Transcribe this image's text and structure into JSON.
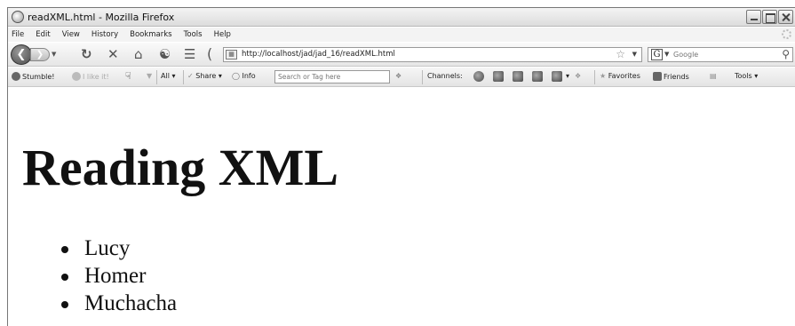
{
  "window": {
    "title": "readXML.html - Mozilla Firefox"
  },
  "menubar": {
    "items": [
      "File",
      "Edit",
      "View",
      "History",
      "Bookmarks",
      "Tools",
      "Help"
    ]
  },
  "navbar": {
    "url": "http://localhost/jad/jad_16/readXML.html",
    "search_engine": "G",
    "search_placeholder": "Google"
  },
  "stumblebar": {
    "stumble_label": "Stumble!",
    "ilike_label": "I like it!",
    "all_label": "All",
    "share_label": "Share",
    "info_label": "Info",
    "search_placeholder": "Search or Tag here",
    "channels_label": "Channels:",
    "favorites_label": "Favorites",
    "friends_label": "Friends",
    "tools_label": "Tools"
  },
  "content": {
    "heading": "Reading XML",
    "items": [
      "Lucy",
      "Homer",
      "Muchacha"
    ]
  }
}
